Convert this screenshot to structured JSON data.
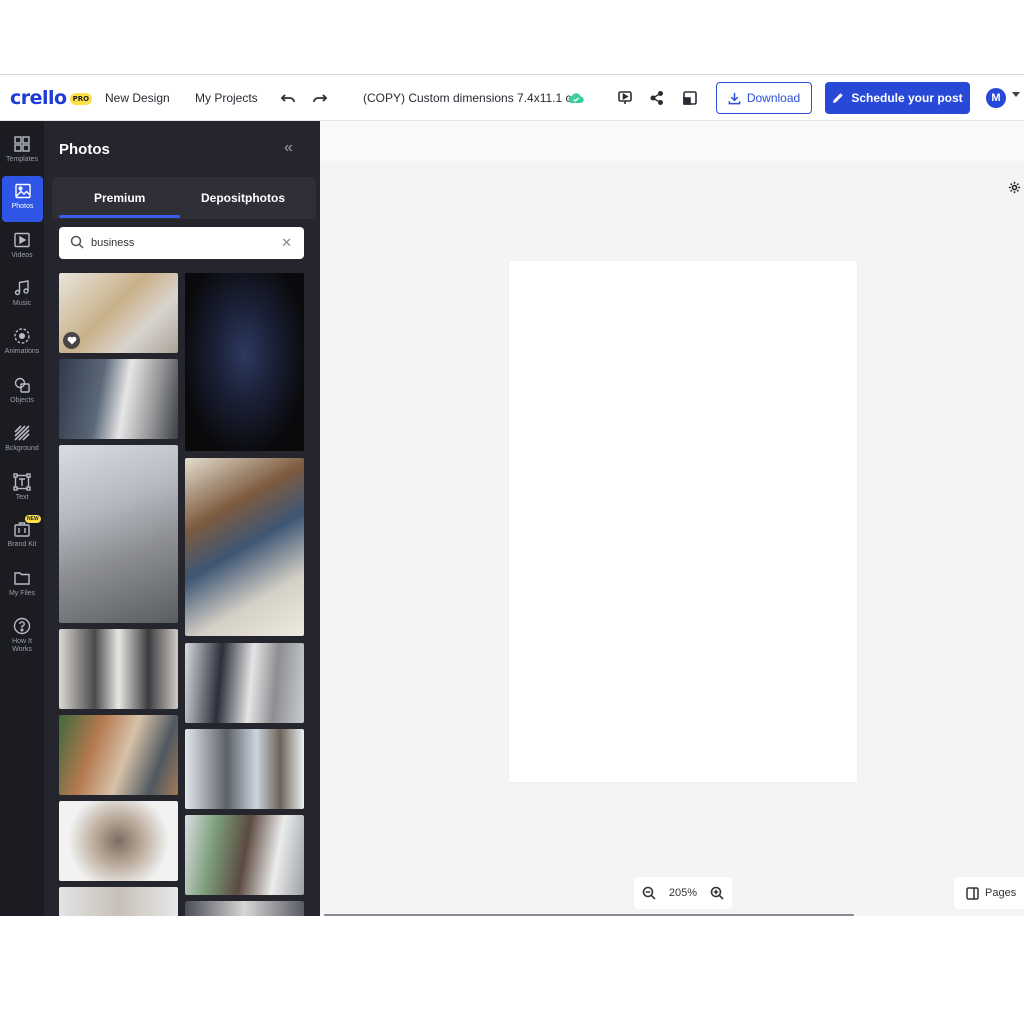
{
  "app": {
    "logo": "crello",
    "logo_badge": "PRO",
    "nav": [
      "New Design",
      "My Projects"
    ],
    "document_title": "(COPY) Custom dimensions 7.4x11.1 cm",
    "download_label": "Download",
    "schedule_label": "Schedule your post",
    "avatar_initial": "M"
  },
  "sidebar": {
    "items": [
      {
        "label": "Templates",
        "icon": "templates-icon"
      },
      {
        "label": "Photos",
        "icon": "photos-icon",
        "active": true
      },
      {
        "label": "Videos",
        "icon": "videos-icon"
      },
      {
        "label": "Music",
        "icon": "music-icon"
      },
      {
        "label": "Animations",
        "icon": "animations-icon"
      },
      {
        "label": "Objects",
        "icon": "objects-icon"
      },
      {
        "label": "Bckground",
        "icon": "background-icon"
      },
      {
        "label": "Text",
        "icon": "text-icon"
      },
      {
        "label": "Brand Kit",
        "icon": "brand-kit-icon",
        "badge": "NEW"
      },
      {
        "label": "My Files",
        "icon": "folder-icon"
      },
      {
        "label": "How It Works",
        "icon": "help-icon"
      }
    ]
  },
  "panel": {
    "title": "Photos",
    "tabs": [
      {
        "label": "Premium",
        "active": true
      },
      {
        "label": "Depositphotos",
        "active": false
      }
    ],
    "search_value": "business"
  },
  "canvas": {
    "zoom": "205%",
    "pages_label": "Pages"
  },
  "colors": {
    "accent": "#2849d8",
    "sidebar_bg": "#1b1c22",
    "panel_bg": "#25262d",
    "canvas_bg": "#f4f4f6"
  }
}
